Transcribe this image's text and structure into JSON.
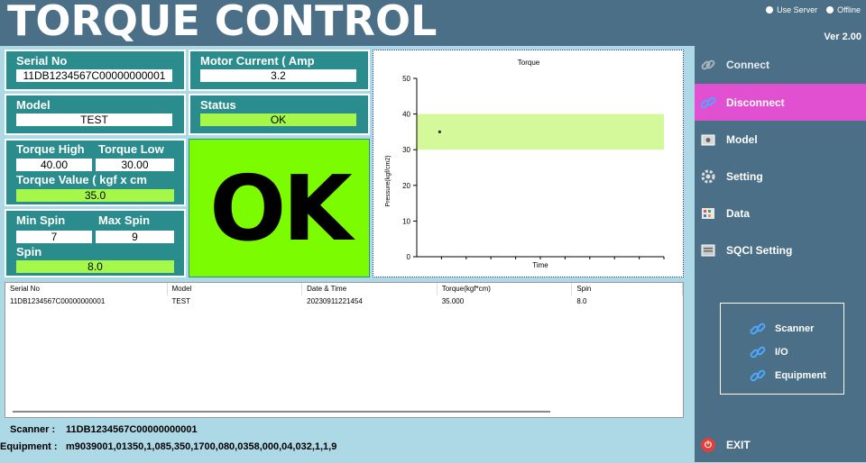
{
  "header": {
    "title": "TORQUE CONTROL",
    "use_server": "Use Server",
    "offline": "Offline",
    "version": "Ver 2.00"
  },
  "serial": {
    "label": "Serial No",
    "value": "11DB1234567C00000000001"
  },
  "motor": {
    "label": "Motor Current ( Amp",
    "value": "3.2"
  },
  "model": {
    "label": "Model",
    "value": "TEST"
  },
  "status": {
    "label": "Status",
    "value": "OK"
  },
  "torque": {
    "high_label": "Torque High",
    "high_value": "40.00",
    "low_label": "Torque Low",
    "low_value": "30.00",
    "value_label": "Torque Value ( kgf x cm",
    "value": "35.0"
  },
  "spin": {
    "min_label": "Min Spin",
    "min_value": "7",
    "max_label": "Max Spin",
    "max_value": "9",
    "label": "Spin",
    "value": "8.0"
  },
  "result": "OK",
  "chart_data": {
    "type": "scatter",
    "title": "Torque",
    "xlabel": "Time",
    "ylabel": "Pressure(kgf/cm2)",
    "ylim": [
      0,
      50
    ],
    "yticks": [
      "0",
      "10",
      "20",
      "30",
      "40",
      "50"
    ],
    "band": {
      "low": 30,
      "high": 40,
      "color": "#d4f99a"
    },
    "points": [
      {
        "x": 1,
        "y": 35
      }
    ],
    "xlim": [
      0,
      10
    ],
    "grid": false
  },
  "table": {
    "headers": [
      "Serial No",
      "Model",
      "Date & Time",
      "Torque(kgf*cm)",
      "Spin"
    ],
    "rows": [
      [
        "11DB1234567C00000000001",
        "TEST",
        "20230911221454",
        "35.000",
        "8.0"
      ]
    ]
  },
  "footer": {
    "scanner_label": "Scanner :",
    "scanner_value": "11DB1234567C00000000001",
    "equipment_label": "Equipment :",
    "equipment_value": "m9039001,01350,1,085,350,1700,080,0358,000,04,032,1,1,9"
  },
  "sidebar": {
    "items": [
      {
        "label": "Connect",
        "icon": "link-icon"
      },
      {
        "label": "Disconnect",
        "icon": "unlink-icon"
      },
      {
        "label": "Model",
        "icon": "model-icon"
      },
      {
        "label": "Setting",
        "icon": "gear-icon"
      },
      {
        "label": "Data",
        "icon": "data-icon"
      },
      {
        "label": "SQCI Setting",
        "icon": "sqci-icon"
      }
    ],
    "devices": [
      {
        "label": "Scanner"
      },
      {
        "label": "I/O"
      },
      {
        "label": "Equipment"
      }
    ],
    "exit": "EXIT"
  }
}
